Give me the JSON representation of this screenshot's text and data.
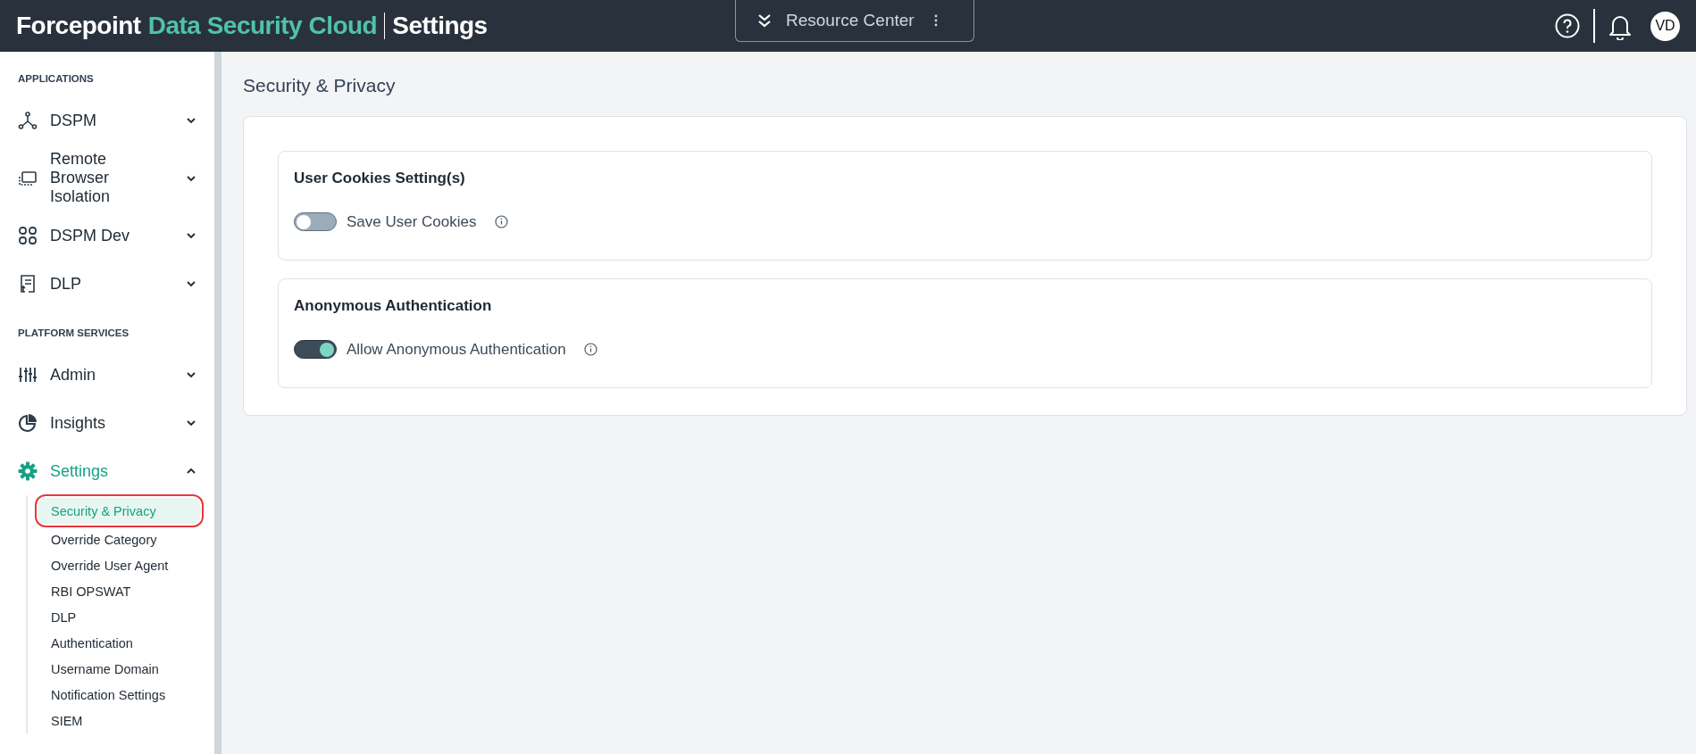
{
  "header": {
    "brand": "Forcepoint",
    "product": "Data Security Cloud",
    "section": "Settings",
    "resource_center": "Resource Center",
    "avatar": "VD"
  },
  "sidebar": {
    "sections": [
      {
        "heading": "APPLICATIONS",
        "items": [
          {
            "label": "DSPM",
            "kind": "nodes",
            "expanded": false,
            "selected": false
          },
          {
            "label": "Remote Browser Isolation",
            "kind": "screen",
            "expanded": false,
            "selected": false
          },
          {
            "label": "DSPM Dev",
            "kind": "grid",
            "expanded": false,
            "selected": false
          },
          {
            "label": "DLP",
            "kind": "doc",
            "expanded": false,
            "selected": false
          }
        ]
      },
      {
        "heading": "PLATFORM SERVICES",
        "items": [
          {
            "label": "Admin",
            "kind": "sliders",
            "expanded": false,
            "selected": false
          },
          {
            "label": "Insights",
            "kind": "pie",
            "expanded": false,
            "selected": false
          },
          {
            "label": "Settings",
            "kind": "gear",
            "expanded": true,
            "selected": true,
            "children": [
              {
                "label": "Security & Privacy",
                "selected": true
              },
              {
                "label": "Override Category",
                "selected": false
              },
              {
                "label": "Override User Agent",
                "selected": false
              },
              {
                "label": "RBI OPSWAT",
                "selected": false
              },
              {
                "label": "DLP",
                "selected": false
              },
              {
                "label": "Authentication",
                "selected": false
              },
              {
                "label": "Username Domain",
                "selected": false
              },
              {
                "label": "Notification Settings",
                "selected": false
              },
              {
                "label": "SIEM",
                "selected": false
              }
            ]
          }
        ]
      }
    ]
  },
  "page": {
    "title": "Security & Privacy",
    "groups": [
      {
        "title": "User Cookies Setting(s)",
        "settings": [
          {
            "label": "Save User Cookies",
            "on": false
          }
        ]
      },
      {
        "title": "Anonymous Authentication",
        "settings": [
          {
            "label": "Allow Anonymous Authentication",
            "on": true
          }
        ]
      }
    ]
  }
}
